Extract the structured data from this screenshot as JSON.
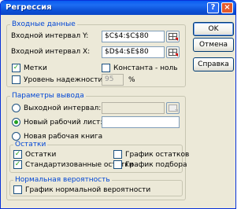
{
  "window": {
    "title": "Регрессия",
    "help_glyph": "?",
    "close_glyph": "×"
  },
  "buttons": {
    "ok": "OK",
    "cancel": "Отмена",
    "help": "Справка"
  },
  "input_group": {
    "label": "Входные данные",
    "y_label": "Входной интервал Y:",
    "y_value": "$C$4:$C$80",
    "x_label": "Входной интервал X:",
    "x_value": "$D$4:$E$80",
    "labels_checkbox": "Метки",
    "labels_checked": true,
    "constant_zero_checkbox": "Константа - ноль",
    "constant_zero_checked": false,
    "confidence_checkbox": "Уровень надежности:",
    "confidence_checked": false,
    "confidence_value": "95",
    "percent_sign": "%"
  },
  "output_group": {
    "label": "Параметры вывода",
    "output_range_radio": "Выходной интервал:",
    "output_range_value": "",
    "new_sheet_radio": "Новый рабочий лист:",
    "new_sheet_value": "",
    "new_workbook_radio": "Новая рабочая книга",
    "selected": "new_sheet"
  },
  "residuals_group": {
    "label": "Остатки",
    "residuals": "Остатки",
    "residuals_checked": true,
    "standardized_residuals": "Стандартизованные остатки",
    "standardized_checked": true,
    "residual_plots": "График остатков",
    "residual_plots_checked": false,
    "line_fit_plots": "График подбора",
    "line_fit_checked": false
  },
  "normal_group": {
    "label": "Нормальная вероятность",
    "normal_plot": "График нормальной вероятности",
    "normal_plot_checked": false
  },
  "colors": {
    "titlebar": "#0a5cf0",
    "group_label": "#0046d5",
    "check_mark": "#21a121"
  }
}
